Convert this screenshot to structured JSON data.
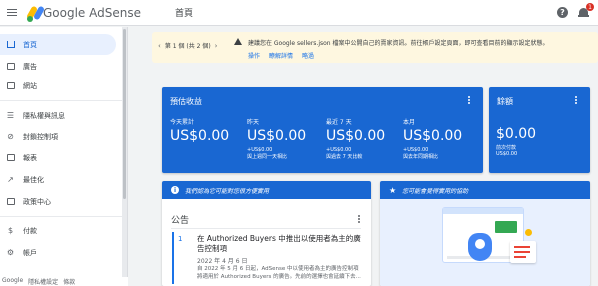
{
  "app": {
    "brand": "Google AdSense",
    "page_title": "首頁",
    "notification_count": "1"
  },
  "sidebar": {
    "items": [
      {
        "label": "首頁",
        "icon": "home-icon"
      },
      {
        "label": "廣告",
        "icon": "ads-icon"
      },
      {
        "label": "網站",
        "icon": "sites-icon"
      },
      {
        "label": "隱私權與訊息",
        "icon": "privacy-icon"
      },
      {
        "label": "封鎖控制項",
        "icon": "block-icon"
      },
      {
        "label": "報表",
        "icon": "reports-icon"
      },
      {
        "label": "最佳化",
        "icon": "optimize-icon"
      },
      {
        "label": "政策中心",
        "icon": "policy-icon"
      },
      {
        "label": "付款",
        "icon": "payments-icon"
      },
      {
        "label": "帳戶",
        "icon": "account-icon"
      }
    ],
    "footer": [
      "Google",
      "隱私權設定",
      "條款"
    ]
  },
  "notice": {
    "pager": "第 1 個 (共 2 個)",
    "message": "建議您在 Google sellers.json 檔案中公開自己的賣家資訊。前往帳戶設定頁面，即可查看目前的顯示設定狀態。",
    "links": [
      "操作",
      "瞭解詳情",
      "略過"
    ]
  },
  "earnings": {
    "title": "預估收益",
    "columns": [
      {
        "label": "今天累計",
        "value": "US$0.00",
        "delta": "",
        "sub": ""
      },
      {
        "label": "昨天",
        "value": "US$0.00",
        "delta": "+US$0.00",
        "sub": "與上週同一天相比"
      },
      {
        "label": "最近 7 天",
        "value": "US$0.00",
        "delta": "+US$0.00",
        "sub": "與過去 7 天比較"
      },
      {
        "label": "本月",
        "value": "US$0.00",
        "delta": "+US$0.00",
        "sub": "與去年同期相比"
      }
    ]
  },
  "balance": {
    "title": "餘額",
    "value": "$0.00",
    "sub1": "前次付款",
    "sub2": "US$0.00"
  },
  "announcements": {
    "header": "我們認為它可能對您很方便實用",
    "title": "公告",
    "index": "1",
    "headline": "在 Authorized Buyers 中推出以使用者為主的廣告控制項",
    "date": "2022 年 4 月 6 日",
    "body": "自 2022 年 5 月 6 日起，AdSense 中以使用者為主的廣告控制項將適用於 Authorized Buyers 的廣告。先前的選擇也會延續下去..."
  },
  "help": {
    "header": "您可能會覺得實用的協助"
  },
  "colors": {
    "brand_blue": "#1967d2",
    "notice_bg": "#fef7e0",
    "badge_red": "#d93025"
  }
}
